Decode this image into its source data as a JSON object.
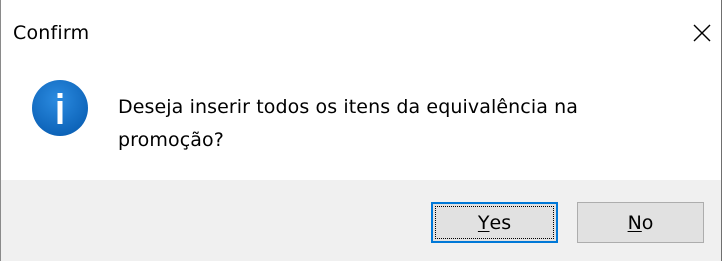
{
  "dialog": {
    "title": "Confirm",
    "close_icon": "close-icon",
    "message_line1": "Deseja inserir todos os itens da equivalência na",
    "message_line2": "promoção?",
    "icon": "info-icon",
    "icon_color": "#1a73c8",
    "footer_color": "#f0f0f0"
  },
  "buttons": {
    "yes": {
      "mnemonic": "Y",
      "rest": "es",
      "focused": true
    },
    "no": {
      "mnemonic": "N",
      "rest": "o",
      "focused": false
    }
  }
}
